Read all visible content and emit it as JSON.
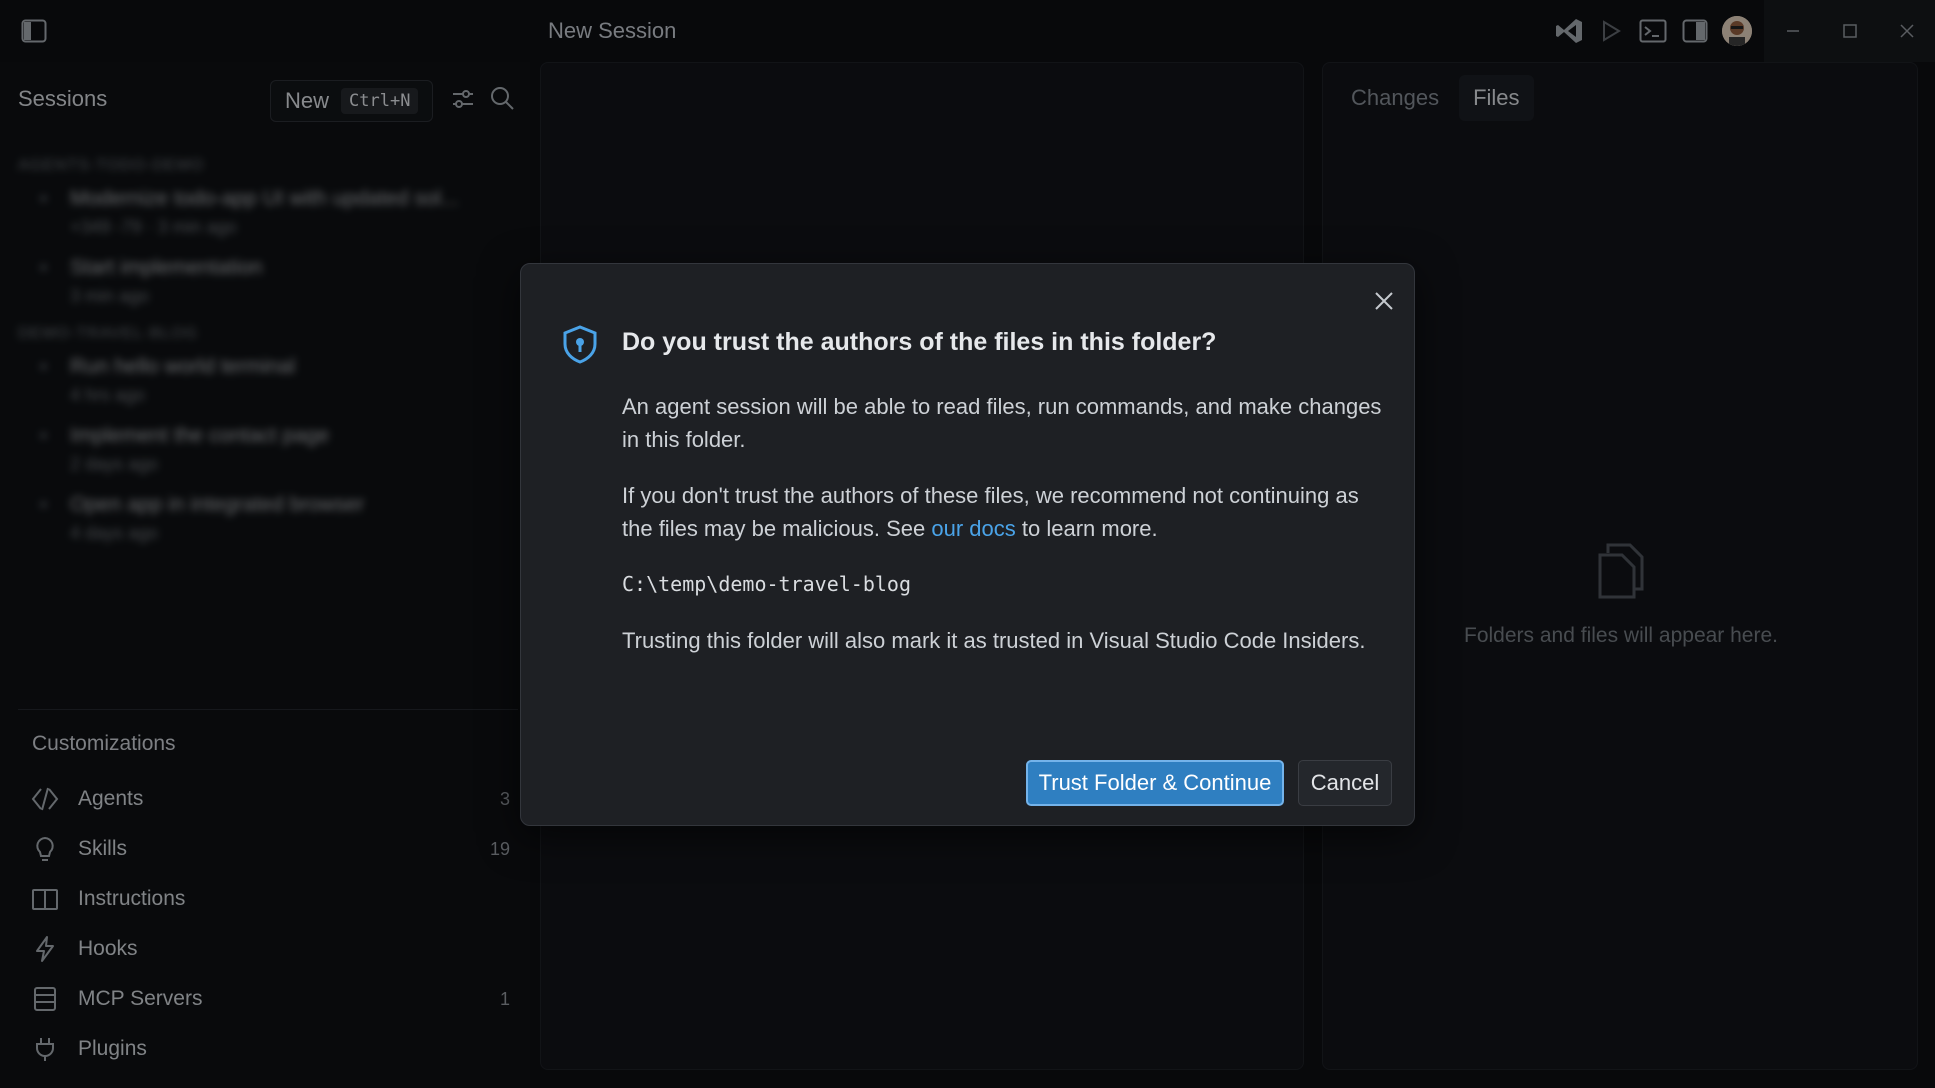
{
  "titlebar": {
    "title": "New Session",
    "icons": [
      "sidebar-toggle-icon",
      "vscode-logo-icon",
      "run-icon",
      "terminal-icon",
      "panel-icon",
      "avatar",
      "minimize-icon",
      "maximize-icon",
      "close-icon"
    ]
  },
  "sidebar": {
    "sessions_label": "Sessions",
    "new_label": "New",
    "new_shortcut": "Ctrl+N",
    "groups": [
      {
        "label": "AGENTS-TODO-DEMO",
        "items": [
          {
            "title": "Modernize todo-app UI with updated sol...",
            "meta": "+349 -79 · 3 min ago"
          },
          {
            "title": "Start implementation",
            "meta": "3 min ago"
          }
        ]
      },
      {
        "label": "DEMO-TRAVEL-BLOG",
        "items": [
          {
            "title": "Run hello world terminal",
            "meta": "4 hrs ago"
          },
          {
            "title": "Implement the contact page",
            "meta": "2 days ago"
          },
          {
            "title": "Open app in integrated browser",
            "meta": "4 days ago"
          }
        ]
      }
    ],
    "customizations_label": "Customizations",
    "customizations": [
      {
        "label": "Agents",
        "count": "3",
        "icon": "agents-icon"
      },
      {
        "label": "Skills",
        "count": "19",
        "icon": "lightbulb-icon"
      },
      {
        "label": "Instructions",
        "count": "",
        "icon": "book-icon"
      },
      {
        "label": "Hooks",
        "count": "",
        "icon": "lightning-icon"
      },
      {
        "label": "MCP Servers",
        "count": "1",
        "icon": "server-icon"
      },
      {
        "label": "Plugins",
        "count": "",
        "icon": "plug-icon"
      }
    ]
  },
  "right_panel": {
    "tabs": [
      "Changes",
      "Files"
    ],
    "active_tab": "Files",
    "empty_text": "Folders and files will appear here."
  },
  "dialog": {
    "title": "Do you trust the authors of the files in this folder?",
    "para1": "An agent session will be able to read files, run commands, and make changes in this folder.",
    "para2_before": "If you don't trust the authors of these files, we recommend not continuing as the files may be malicious. See ",
    "para2_link": "our docs",
    "para2_after": " to learn more.",
    "path": "C:\\temp\\demo-travel-blog",
    "para3": "Trusting this folder will also mark it as trusted in Visual Studio Code Insiders.",
    "trust_button": "Trust Folder & Continue",
    "cancel_button": "Cancel"
  },
  "colors": {
    "accent": "#2f7fc1",
    "link": "#4aa3e8",
    "background": "#0d0f12",
    "dialog_bg": "#1e2024"
  }
}
